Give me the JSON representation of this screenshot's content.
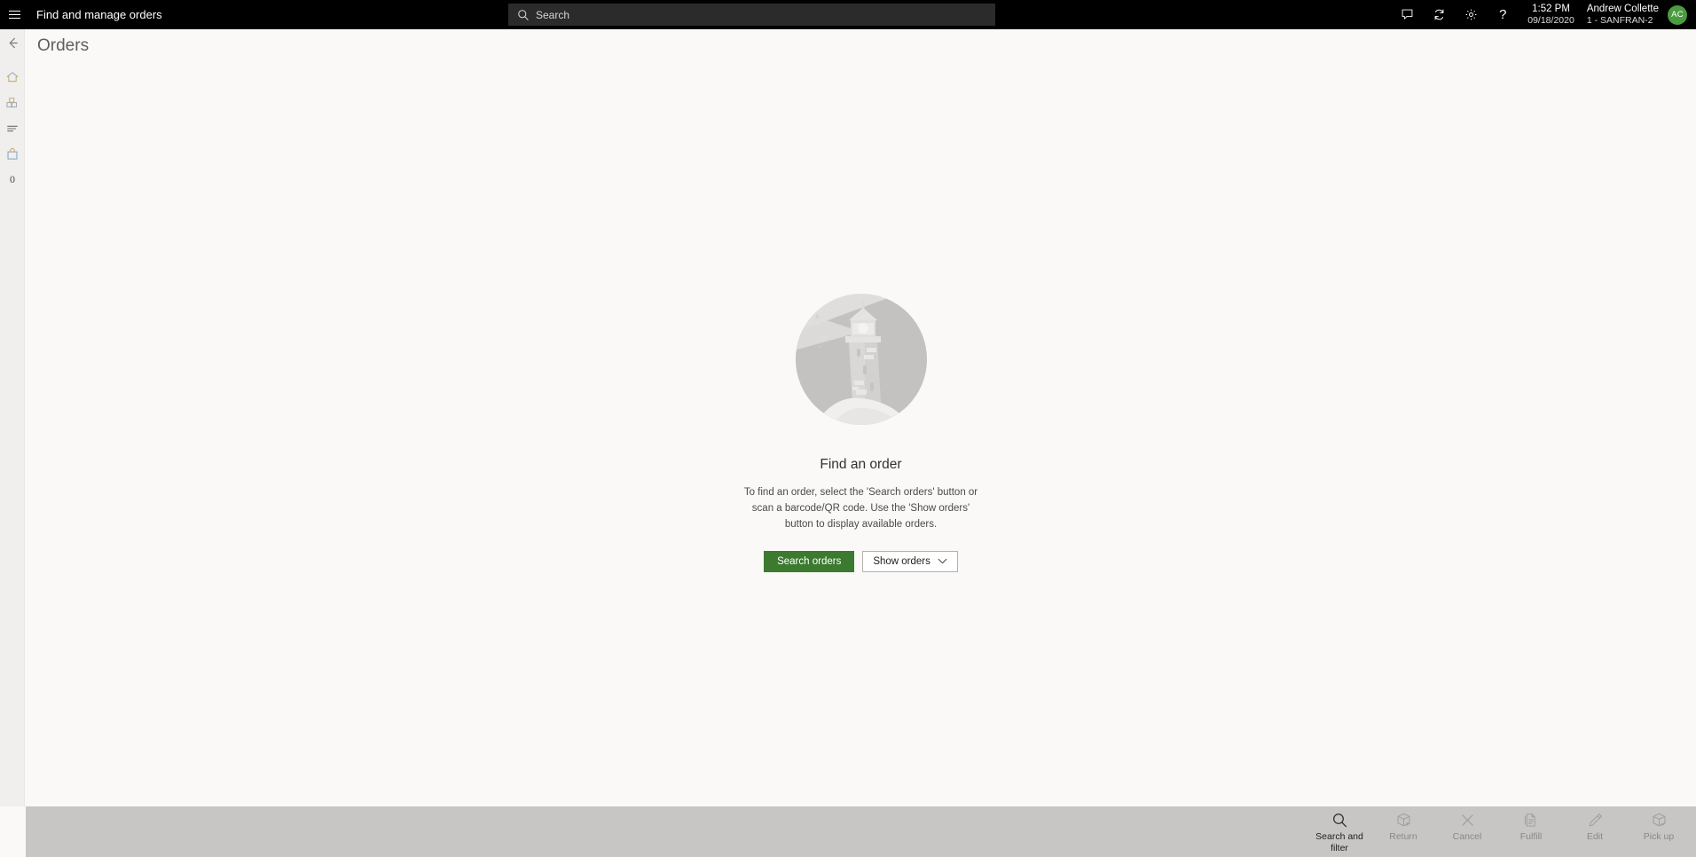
{
  "appbar": {
    "menu_icon": "hamburger-icon",
    "title": "Find and manage orders",
    "search": {
      "icon": "search-icon",
      "placeholder": "Search",
      "value": ""
    },
    "icons": [
      {
        "name": "message-icon",
        "label": "Messages"
      },
      {
        "name": "refresh-icon",
        "label": "Refresh"
      },
      {
        "name": "gear-icon",
        "label": "Settings"
      },
      {
        "name": "help-icon",
        "label": "?"
      }
    ],
    "clock": {
      "time": "1:52 PM",
      "date": "09/18/2020"
    },
    "user": {
      "name": "Andrew Collette",
      "store": "1 - SANFRAN-2",
      "initials": "AC",
      "avatar_color": "#4a9c3f"
    }
  },
  "rail": {
    "items": [
      {
        "name": "back-arrow-icon",
        "label": "Back"
      },
      {
        "name": "home-icon",
        "label": "Home"
      },
      {
        "name": "products-icon",
        "label": "Products"
      },
      {
        "name": "list-icon",
        "label": "Tasks"
      },
      {
        "name": "shopping-bag-icon",
        "label": "Cart"
      },
      {
        "name": "cart-count",
        "label": "0"
      }
    ],
    "cart_count": "0"
  },
  "main": {
    "page_title": "Orders",
    "empty_state": {
      "illustration": "lighthouse-illustration",
      "title": "Find an order",
      "description": "To find an order, select the 'Search orders' button or scan a barcode/QR code. Use the 'Show orders' button to display available orders.",
      "primary_button": "Search orders",
      "secondary_button": "Show orders",
      "secondary_chevron": "chevron-down-icon"
    }
  },
  "commandbar": {
    "items": [
      {
        "icon": "magnifier-icon",
        "label": "Search and filter",
        "disabled": false
      },
      {
        "icon": "return-box-icon",
        "label": "Return",
        "disabled": true
      },
      {
        "icon": "close-x-icon",
        "label": "Cancel",
        "disabled": true
      },
      {
        "icon": "document-icon",
        "label": "Fulfill",
        "disabled": true
      },
      {
        "icon": "pencil-icon",
        "label": "Edit",
        "disabled": true
      },
      {
        "icon": "pickup-box-icon",
        "label": "Pick up",
        "disabled": true
      }
    ]
  },
  "colors": {
    "appbar_bg": "#000000",
    "search_bg": "#2b2b2b",
    "rail_bg": "#f0efee",
    "content_bg": "#faf9f8",
    "cmdbar_bg": "#c8c6c4",
    "primary_green": "#3b7a2f",
    "avatar_green": "#4a9c3f"
  }
}
